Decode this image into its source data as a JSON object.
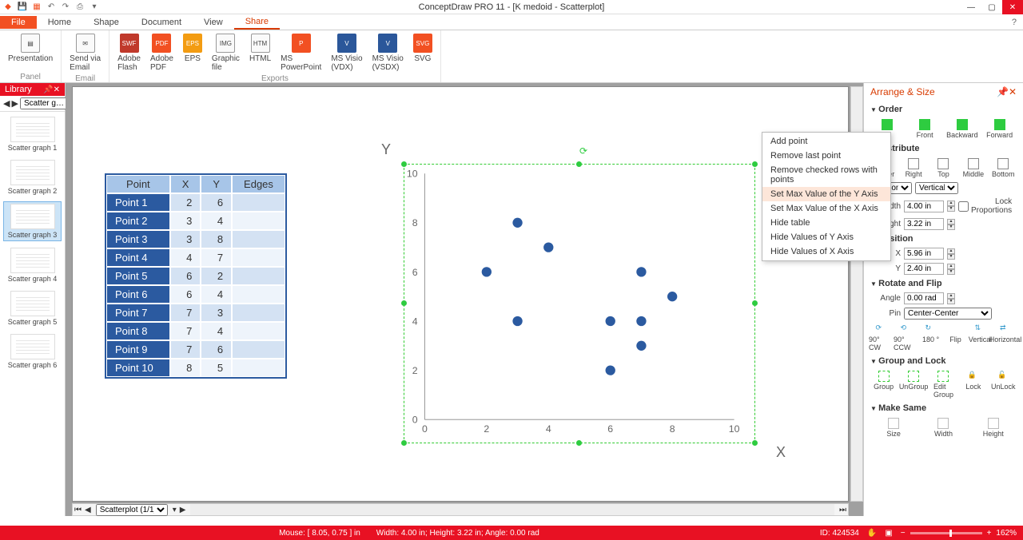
{
  "app_title": "ConceptDraw PRO 11 - [K medoid - Scatterplot]",
  "tabs": {
    "file": "File",
    "home": "Home",
    "shape": "Shape",
    "document": "Document",
    "view": "View",
    "share": "Share"
  },
  "ribbon": {
    "panel_grp": "Panel",
    "email_grp": "Email",
    "exports_grp": "Exports",
    "presentation": "Presentation",
    "send_email": "Send via\nEmail",
    "adobe_flash": "Adobe\nFlash",
    "adobe_pdf": "Adobe\nPDF",
    "eps": "EPS",
    "graphic": "Graphic\nfile",
    "html": "HTML",
    "ms_ppt": "MS\nPowerPoint",
    "visio_vdx": "MS Visio\n(VDX)",
    "visio_vsdx": "MS Visio\n(VSDX)",
    "svg": "SVG"
  },
  "library": {
    "title": "Library",
    "combo": "Scatter g…",
    "items": [
      "Scatter graph 1",
      "Scatter graph 2",
      "Scatter graph 3",
      "Scatter graph 4",
      "Scatter graph 5",
      "Scatter graph 6"
    ]
  },
  "table": {
    "headers": [
      "Point",
      "X",
      "Y",
      "Edges"
    ],
    "rows": [
      [
        "Point 1",
        "2",
        "6",
        ""
      ],
      [
        "Point 2",
        "3",
        "4",
        ""
      ],
      [
        "Point 3",
        "3",
        "8",
        ""
      ],
      [
        "Point 4",
        "4",
        "7",
        ""
      ],
      [
        "Point 5",
        "6",
        "2",
        ""
      ],
      [
        "Point 6",
        "6",
        "4",
        ""
      ],
      [
        "Point 7",
        "7",
        "3",
        ""
      ],
      [
        "Point 8",
        "7",
        "4",
        ""
      ],
      [
        "Point 9",
        "7",
        "6",
        ""
      ],
      [
        "Point 10",
        "8",
        "5",
        ""
      ]
    ]
  },
  "chart_data": {
    "type": "scatter",
    "title": "",
    "xlabel": "X",
    "ylabel": "Y",
    "xlim": [
      0,
      10
    ],
    "ylim": [
      0,
      10
    ],
    "x_ticks": [
      0,
      2,
      4,
      6,
      8,
      10
    ],
    "y_ticks": [
      0,
      2,
      4,
      6,
      8,
      10
    ],
    "series": [
      {
        "name": "points",
        "values": [
          {
            "x": 2,
            "y": 6
          },
          {
            "x": 3,
            "y": 4
          },
          {
            "x": 3,
            "y": 8
          },
          {
            "x": 4,
            "y": 7
          },
          {
            "x": 6,
            "y": 2
          },
          {
            "x": 6,
            "y": 4
          },
          {
            "x": 7,
            "y": 3
          },
          {
            "x": 7,
            "y": 4
          },
          {
            "x": 7,
            "y": 6
          },
          {
            "x": 8,
            "y": 5
          }
        ]
      }
    ]
  },
  "context_menu": {
    "items": [
      "Add point",
      "Remove last point",
      "Remove checked rows with points",
      "Set Max Value of the Y Axis",
      "Set Max Value of the X Axis",
      "Hide table",
      "Hide Values of Y Axis",
      "Hide Values of X Axis"
    ],
    "highlight_index": 3
  },
  "arrange": {
    "title": "Arrange & Size",
    "order": "Order",
    "order_items": {
      "front": "Front",
      "backward": "Backward",
      "forward": "Forward"
    },
    "distribute": "Distribute",
    "dist_items": {
      "center": "Center",
      "right": "Right",
      "top": "Top",
      "middle": "Middle",
      "bottom": "Bottom"
    },
    "orient_h": "Horizontal",
    "orient_v": "Vertical",
    "width_lbl": "Width",
    "width_val": "4.00 in",
    "height_lbl": "Height",
    "height_val": "3.22 in",
    "lockprop": "Lock Proportions",
    "position": "Position",
    "x_lbl": "X",
    "x_val": "5.96 in",
    "y_lbl": "Y",
    "y_val": "2.40 in",
    "rotateflip": "Rotate and Flip",
    "angle_lbl": "Angle",
    "angle_val": "0.00 rad",
    "pin_lbl": "Pin",
    "pin_val": "Center-Center",
    "rot_items": {
      "cw": "90° CW",
      "ccw": "90° CCW",
      "r180": "180 °",
      "flip": "Flip",
      "vert": "Vertical",
      "horiz": "Horizontal"
    },
    "grouplock": "Group and Lock",
    "gl_items": {
      "group": "Group",
      "ungroup": "UnGroup",
      "editgrp": "Edit\nGroup",
      "lock": "Lock",
      "unlock": "UnLock"
    },
    "makesame": "Make Same",
    "ms_items": {
      "size": "Size",
      "width": "Width",
      "height": "Height"
    }
  },
  "pager": "Scatterplot (1/1)",
  "status": {
    "mouse": "Mouse: [ 8.05, 0.75 ] in",
    "size": "Width: 4.00 in;  Height: 3.22 in;  Angle: 0.00 rad",
    "id": "ID: 424534",
    "zoom": "162%"
  }
}
